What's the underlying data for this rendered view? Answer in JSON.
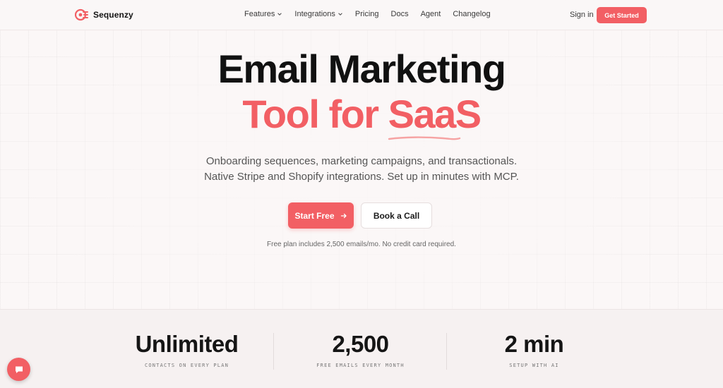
{
  "nav": {
    "brand": "Sequenzy",
    "links": [
      {
        "label": "Features",
        "dropdown": true
      },
      {
        "label": "Integrations",
        "dropdown": true
      },
      {
        "label": "Pricing",
        "dropdown": false
      },
      {
        "label": "Docs",
        "dropdown": false
      },
      {
        "label": "Agent",
        "dropdown": false
      },
      {
        "label": "Changelog",
        "dropdown": false
      }
    ],
    "signin": "Sign in",
    "cta": "Get Started"
  },
  "hero": {
    "line1": "Email Marketing",
    "line2": "Tool for SaaS",
    "subtitle_1": "Onboarding sequences, marketing campaigns, and transactionals.",
    "subtitle_2": "Native Stripe and Shopify integrations. Set up in minutes with MCP.",
    "primary_button": "Start Free",
    "secondary_button": "Book a Call",
    "note": "Free plan includes 2,500 emails/mo. No credit card required."
  },
  "stats": [
    {
      "value": "Unlimited",
      "label": "CONTACTS ON EVERY PLAN"
    },
    {
      "value": "2,500",
      "label": "FREE EMAILS EVERY MONTH"
    },
    {
      "value": "2 min",
      "label": "SETUP WITH AI"
    }
  ],
  "colors": {
    "accent": "#f25f64",
    "heading": "#111111",
    "background": "#fbf7f7"
  },
  "icons": {
    "logo": "sequenzy-logo-icon",
    "dropdown": "chevron-down-icon",
    "arrow": "arrow-right-icon",
    "chat": "chat-bubble-icon"
  }
}
